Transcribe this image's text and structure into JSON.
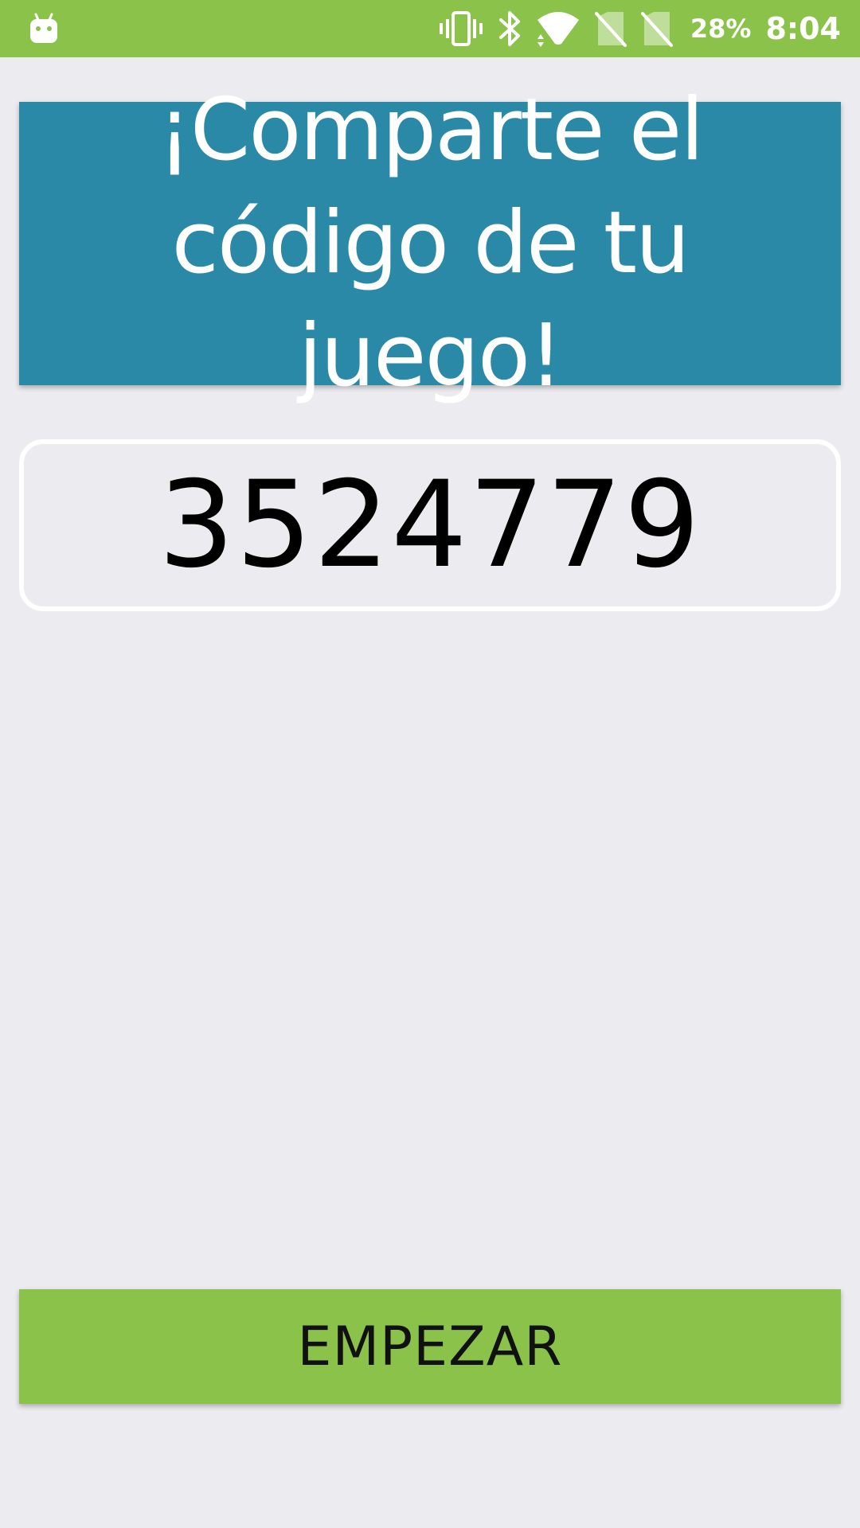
{
  "status_bar": {
    "battery_percent": "28%",
    "time": "8:04",
    "icons": [
      "android-icon",
      "vibrate-icon",
      "bluetooth-icon",
      "wifi-icon",
      "no-sim-icon",
      "no-sim-icon"
    ],
    "background_color": "#8bc34a"
  },
  "header": {
    "title": "¡Comparte el código de tu juego!",
    "background_color": "#2b89a8"
  },
  "game_code": {
    "value": "3524779"
  },
  "start_button": {
    "label": "EMPEZAR",
    "background_color": "#8bc34a"
  }
}
